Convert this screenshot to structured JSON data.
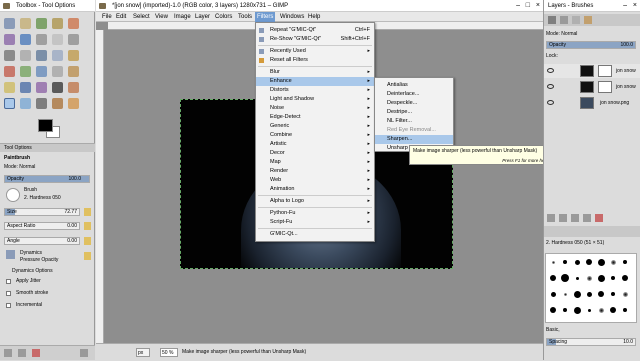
{
  "toolbox": {
    "title": "Toolbox - Tool Options",
    "tool_options_tab": "Tool Options",
    "tool_name": "Paintbrush",
    "mode_label": "Mode: Normal",
    "opacity_label": "Opacity",
    "opacity_value": "100.0",
    "opacity_fraction": 1.0,
    "brush_label": "Brush",
    "brush_value": "2. Hardness 050",
    "size_label": "Size",
    "size_value": "72.77",
    "aspect_label": "Aspect Ratio",
    "aspect_value": "0.00",
    "angle_label": "Angle",
    "angle_value": "0.00",
    "dynamics_label": "Dynamics",
    "dynamics_value": "Pressure Opacity",
    "dynamics_options": "Dynamics Options",
    "apply_jitter": "Apply Jitter",
    "smooth_stroke": "Smooth stroke",
    "incremental": "Incremental"
  },
  "main": {
    "title": "*[jon snow] (imported)-1.0 (RGB color, 3 layers) 1280x731 – GIMP",
    "menus": [
      "File",
      "Edit",
      "Select",
      "View",
      "Image",
      "Layer",
      "Colors",
      "Tools",
      "Filters",
      "Windows",
      "Help"
    ],
    "active_menu": "Filters",
    "zoom_value": "50 %",
    "unit_value": "px",
    "status_text": "Make image sharper (less powerful than Unsharp Mask)"
  },
  "filters_menu": {
    "items": [
      {
        "label": "Repeat \"G'MIC-Qt\"",
        "shortcut": "Ctrl+F"
      },
      {
        "label": "Re-Show \"G'MIC-Qt\"",
        "shortcut": "Shift+Ctrl+F"
      },
      {
        "label": "Recently Used",
        "shortcut": "▸"
      },
      {
        "label": "Reset all Filters",
        "shortcut": ""
      },
      {
        "label": "Blur",
        "shortcut": "▸"
      },
      {
        "label": "Enhance",
        "shortcut": "▸"
      },
      {
        "label": "Distorts",
        "shortcut": "▸"
      },
      {
        "label": "Light and Shadow",
        "shortcut": "▸"
      },
      {
        "label": "Noise",
        "shortcut": "▸"
      },
      {
        "label": "Edge-Detect",
        "shortcut": "▸"
      },
      {
        "label": "Generic",
        "shortcut": "▸"
      },
      {
        "label": "Combine",
        "shortcut": "▸"
      },
      {
        "label": "Artistic",
        "shortcut": "▸"
      },
      {
        "label": "Decor",
        "shortcut": "▸"
      },
      {
        "label": "Map",
        "shortcut": "▸"
      },
      {
        "label": "Render",
        "shortcut": "▸"
      },
      {
        "label": "Web",
        "shortcut": "▸"
      },
      {
        "label": "Animation",
        "shortcut": "▸"
      },
      {
        "label": "Alpha to Logo",
        "shortcut": "▸"
      },
      {
        "label": "Python-Fu",
        "shortcut": "▸"
      },
      {
        "label": "Script-Fu",
        "shortcut": "▸"
      },
      {
        "label": "G'MIC-Qt...",
        "shortcut": ""
      }
    ]
  },
  "enhance_menu": {
    "items": [
      "Antialias",
      "Deinterlace...",
      "Despeckle...",
      "Destripe...",
      "NL Filter...",
      "Red Eye Removal...",
      "Sharpen...",
      "Unsharp Mask..."
    ]
  },
  "tooltip": {
    "text": "Make image sharper (less powerful than Unsharp Mask)",
    "hint": "Press F1 for more help"
  },
  "layers": {
    "title": "Layers - Brushes",
    "mode_label": "Mode: Normal",
    "opacity_label": "Opacity",
    "opacity_value": "100.0",
    "lock_label": "Lock:",
    "items": [
      {
        "name": "jon snow"
      },
      {
        "name": "jon snow"
      },
      {
        "name": "jon snow.png"
      }
    ],
    "brush_name": "2. Hardness 050 (51 × 51)",
    "basic_label": "Basic,",
    "spacing_label": "Spacing",
    "spacing_value": "10.0"
  },
  "colors": {
    "accent": "#6e9ad0",
    "highlight": "#a9c8ea",
    "tooltip_bg": "#ffffe4"
  }
}
